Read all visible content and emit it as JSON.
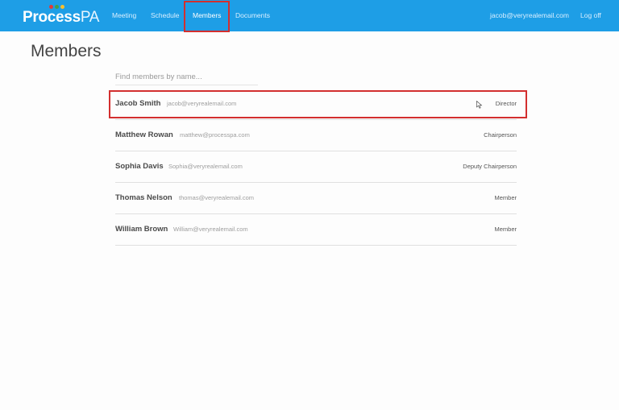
{
  "navbar": {
    "brand_bold": "Process",
    "brand_light": "PA",
    "brand_dot_colors": [
      "#e53935",
      "#43a047",
      "#fbc02d"
    ],
    "links": [
      {
        "label": "Meeting"
      },
      {
        "label": "Schedule"
      },
      {
        "label": "Members",
        "active": true
      },
      {
        "label": "Documents"
      }
    ],
    "user_email": "jacob@veryrealemail.com",
    "logoff_label": "Log off"
  },
  "main": {
    "title": "Members",
    "search_placeholder": "Find members by name...",
    "members": [
      {
        "name": "Jacob Smith",
        "email": "jacob@veryrealemail.com",
        "role": "Director"
      },
      {
        "name": "Matthew Rowan",
        "email": "matthew@processpa.com",
        "role": "Chairperson"
      },
      {
        "name": "Sophia Davis",
        "email": "Sophia@veryrealemail.com",
        "role": "Deputy Chairperson"
      },
      {
        "name": "Thomas Nelson",
        "email": "thomas@veryrealemail.com",
        "role": "Member"
      },
      {
        "name": "William Brown",
        "email": "William@veryrealemail.com",
        "role": "Member"
      }
    ]
  },
  "colors": {
    "navbar": "#1e9ee6",
    "highlight": "#d32f2f"
  }
}
